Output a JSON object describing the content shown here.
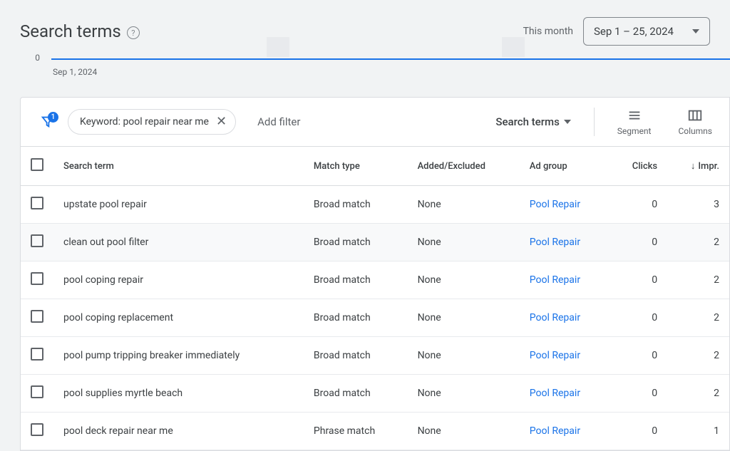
{
  "header": {
    "title": "Search terms",
    "period_label": "This month",
    "date_range": "Sep 1 – 25, 2024"
  },
  "chart": {
    "y0": "0",
    "x0": "Sep 1, 2024"
  },
  "toolbar": {
    "filter_badge": "1",
    "chip_label": "Keyword: pool repair near me",
    "add_filter": "Add filter",
    "view_label": "Search terms",
    "segment_label": "Segment",
    "columns_label": "Columns"
  },
  "table": {
    "headers": {
      "search_term": "Search term",
      "match_type": "Match type",
      "added_excluded": "Added/Excluded",
      "ad_group": "Ad group",
      "clicks": "Clicks",
      "impr": "Impr."
    },
    "rows": [
      {
        "term": "upstate pool repair",
        "match": "Broad match",
        "added": "None",
        "adgroup": "Pool Repair",
        "clicks": "0",
        "impr": "3",
        "hl": false
      },
      {
        "term": "clean out pool filter",
        "match": "Broad match",
        "added": "None",
        "adgroup": "Pool Repair",
        "clicks": "0",
        "impr": "2",
        "hl": true
      },
      {
        "term": "pool coping repair",
        "match": "Broad match",
        "added": "None",
        "adgroup": "Pool Repair",
        "clicks": "0",
        "impr": "2",
        "hl": false
      },
      {
        "term": "pool coping replacement",
        "match": "Broad match",
        "added": "None",
        "adgroup": "Pool Repair",
        "clicks": "0",
        "impr": "2",
        "hl": false
      },
      {
        "term": "pool pump tripping breaker immediately",
        "match": "Broad match",
        "added": "None",
        "adgroup": "Pool Repair",
        "clicks": "0",
        "impr": "2",
        "hl": false
      },
      {
        "term": "pool supplies myrtle beach",
        "match": "Broad match",
        "added": "None",
        "adgroup": "Pool Repair",
        "clicks": "0",
        "impr": "2",
        "hl": false
      },
      {
        "term": "pool deck repair near me",
        "match": "Phrase match",
        "added": "None",
        "adgroup": "Pool Repair",
        "clicks": "0",
        "impr": "1",
        "hl": false
      }
    ]
  }
}
